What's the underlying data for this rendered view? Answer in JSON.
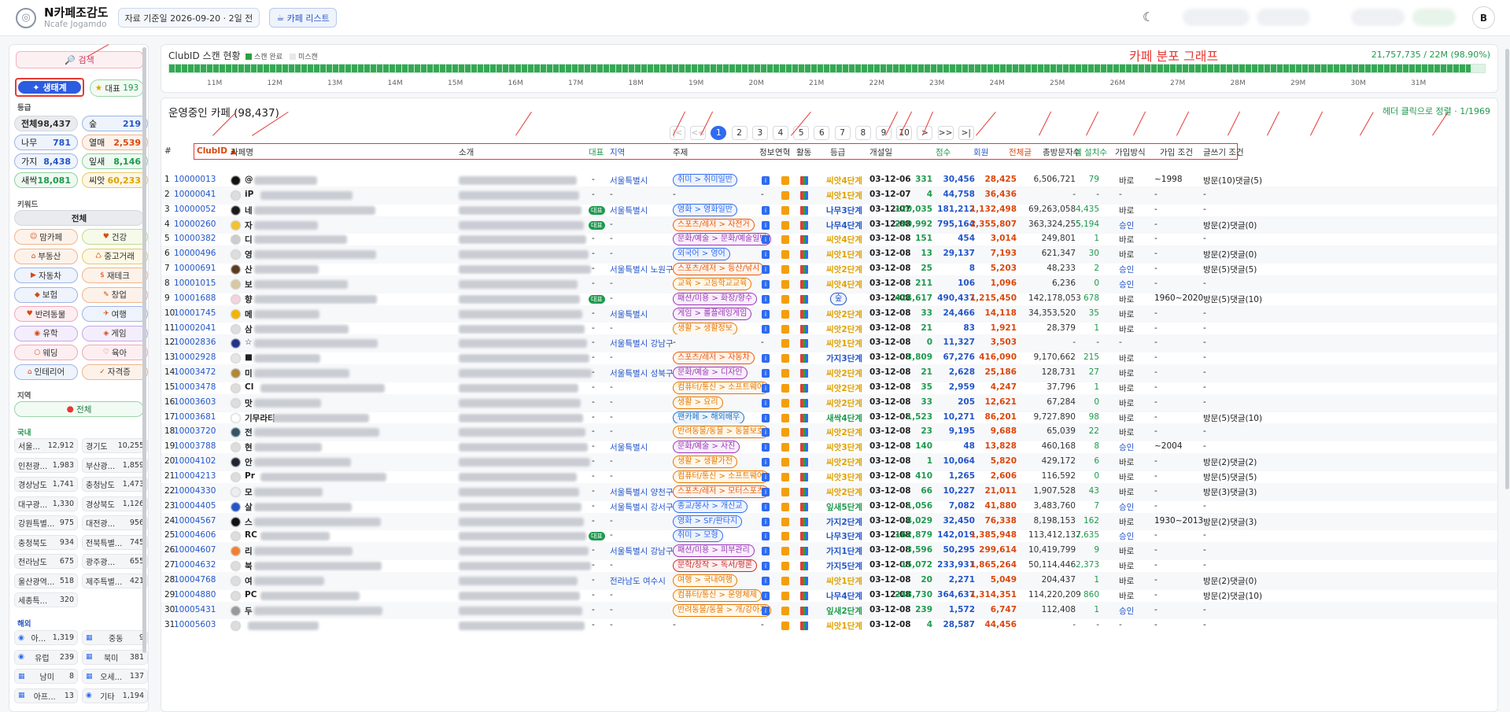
{
  "header": {
    "title": "N카페조감도",
    "subtitle": "Ncafe Jogamdo",
    "data_date": "자료 기준일 2026-09-20 · 2일 전",
    "cafe_list": "카페 리스트",
    "avatar": "B",
    "icon": "moon-icon"
  },
  "sidebar": {
    "search": "검색",
    "ecosystem": "생태계",
    "rep_label": "대표",
    "rep_count": "193",
    "grade_title": "등급",
    "grades": [
      {
        "l": "전체",
        "v": "98,437",
        "c": "#333"
      },
      {
        "l": "숲",
        "v": "219",
        "c": "#2456c8"
      },
      {
        "l": "나무",
        "v": "781",
        "c": "#2456c8"
      },
      {
        "l": "열매",
        "v": "2,539",
        "c": "#d9480f"
      },
      {
        "l": "가지",
        "v": "8,438",
        "c": "#2456c8"
      },
      {
        "l": "잎새",
        "v": "8,146",
        "c": "#1f9a4e"
      },
      {
        "l": "새싹",
        "v": "18,081",
        "c": "#1f9a4e"
      },
      {
        "l": "씨앗",
        "v": "60,233",
        "c": "#e0a100"
      }
    ],
    "keyword_title": "키워드",
    "keyword_all": "전체",
    "keywords": [
      "맘카페",
      "건강",
      "부동산",
      "중고거래",
      "자동차",
      "재테크",
      "보험",
      "창업",
      "반려동물",
      "여행",
      "유학",
      "게임",
      "웨딩",
      "육아",
      "인테리어",
      "자격증"
    ],
    "region_title": "지역",
    "region_all": "전체",
    "domestic": "국내",
    "regions": [
      {
        "l": "서울...",
        "v": "12,912"
      },
      {
        "l": "경기도",
        "v": "10,255"
      },
      {
        "l": "인천광...",
        "v": "1,983"
      },
      {
        "l": "부산광...",
        "v": "1,859"
      },
      {
        "l": "경상남도",
        "v": "1,741"
      },
      {
        "l": "충청남도",
        "v": "1,473"
      },
      {
        "l": "대구광...",
        "v": "1,330"
      },
      {
        "l": "경상북도",
        "v": "1,126"
      },
      {
        "l": "강원특별...",
        "v": "975"
      },
      {
        "l": "대전광...",
        "v": "956"
      },
      {
        "l": "충청북도",
        "v": "934"
      },
      {
        "l": "전북특별...",
        "v": "745"
      },
      {
        "l": "전라남도",
        "v": "675"
      },
      {
        "l": "광주광...",
        "v": "655"
      },
      {
        "l": "울산광역...",
        "v": "518"
      },
      {
        "l": "제주특별...",
        "v": "421"
      },
      {
        "l": "세종특...",
        "v": "320"
      }
    ],
    "overseas": "해외",
    "overseas_regions": [
      {
        "l": "아...",
        "v": "1,319"
      },
      {
        "l": "중동",
        "v": "9"
      },
      {
        "l": "유럽",
        "v": "239"
      },
      {
        "l": "북미",
        "v": "381"
      },
      {
        "l": "남미",
        "v": "8"
      },
      {
        "l": "오세...",
        "v": "137"
      },
      {
        "l": "아프...",
        "v": "13"
      },
      {
        "l": "기타",
        "v": "1,194"
      }
    ]
  },
  "scan": {
    "label": "ClubID 스캔 현황",
    "legend_done": "스캔 완료",
    "legend_not": "미스캔",
    "graph_title": "카페 분포 그래프",
    "total": "21,757,735 / 22M (98.90%)",
    "fill": 0.989,
    "ticks": [
      "11M",
      "12M",
      "13M",
      "14M",
      "15M",
      "16M",
      "17M",
      "18M",
      "19M",
      "20M",
      "21M",
      "22M",
      "23M",
      "24M",
      "25M",
      "26M",
      "27M",
      "28M",
      "29M",
      "30M",
      "31M"
    ]
  },
  "main": {
    "title": "운영중인 카페 (98,437)",
    "sort_hint": "헤더 클릭으로 정렬 · 1/1969",
    "pages": [
      "|<",
      "<<",
      "1",
      "2",
      "3",
      "4",
      "5",
      "6",
      "7",
      "8",
      "9",
      "10",
      ">",
      ">>",
      ">|"
    ],
    "columns": [
      "#",
      "ClubID ▲",
      "카페명",
      "소개",
      "대표",
      "지역",
      "주제",
      "정보",
      "연혁",
      "활동",
      "등급",
      "개설일",
      "점수",
      "회원",
      "전체글",
      "총방문자수",
      "앱 설치수",
      "가입방식",
      "가입 조건",
      "글쓰기 조건"
    ],
    "rows": [
      [
        "1",
        "10000013",
        "@",
        "-",
        "서울특별시",
        "취미 > 취미일반",
        "씨앗4단계",
        "03-12-06",
        "331",
        "30,456",
        "28,425",
        "6,506,721",
        "79",
        "바로",
        "~1998",
        "방문(10)댓글(5)"
      ],
      [
        "2",
        "10000041",
        "iP",
        "-",
        "-",
        "-",
        "씨앗1단계",
        "03-12-07",
        "4",
        "44,758",
        "36,436",
        "-",
        "-",
        "-",
        "-",
        "-"
      ],
      [
        "3",
        "10000052",
        "네",
        "대표",
        "서울특별시",
        "영화 > 영화일반",
        "나무3단계",
        "03-12-07",
        "120,035",
        "181,212",
        "1,132,498",
        "69,263,058",
        "4,435",
        "바로",
        "-",
        "-"
      ],
      [
        "4",
        "10000260",
        "자",
        "대표",
        "-",
        "스포츠/레저 > 자전거",
        "나무4단계",
        "03-12-08",
        "290,992",
        "795,164",
        "2,355,807",
        "363,324,255",
        "5,194",
        "승인",
        "-",
        "방문(2)댓글(0)"
      ],
      [
        "5",
        "10000382",
        "디",
        "-",
        "-",
        "문화/예술 > 문화/예술일반",
        "씨앗4단계",
        "03-12-08",
        "151",
        "454",
        "3,014",
        "249,801",
        "1",
        "바로",
        "-",
        "-"
      ],
      [
        "6",
        "10000496",
        "영",
        "-",
        "-",
        "외국어 > 영어",
        "씨앗1단계",
        "03-12-08",
        "13",
        "29,137",
        "7,193",
        "621,347",
        "30",
        "바로",
        "-",
        "방문(2)댓글(0)"
      ],
      [
        "7",
        "10000691",
        "산",
        "-",
        "서울특별시 노원구",
        "스포츠/레저 > 등산/낚시",
        "씨앗2단계",
        "03-12-08",
        "25",
        "8",
        "5,203",
        "48,233",
        "2",
        "승인",
        "-",
        "방문(5)댓글(5)"
      ],
      [
        "8",
        "10001015",
        "보",
        "-",
        "-",
        "교육 > 고등학교교육",
        "씨앗4단계",
        "03-12-08",
        "211",
        "106",
        "1,096",
        "6,236",
        "0",
        "승인",
        "-",
        "-"
      ],
      [
        "9",
        "10001688",
        "향",
        "대표",
        "-",
        "패션/미용 > 화장/향수",
        "숲",
        "03-12-08",
        "424,617",
        "490,437",
        "1,215,450",
        "142,178,053",
        "678",
        "바로",
        "1960~2020",
        "방문(5)댓글(10)"
      ],
      [
        "10",
        "10001745",
        "메",
        "-",
        "서울특별시",
        "게임 > 롤플레잉게임",
        "씨앗2단계",
        "03-12-08",
        "33",
        "24,466",
        "14,118",
        "34,353,520",
        "35",
        "바로",
        "-",
        "-"
      ],
      [
        "11",
        "10002041",
        "삼",
        "-",
        "-",
        "생활 > 생활정보",
        "씨앗2단계",
        "03-12-08",
        "21",
        "83",
        "1,921",
        "28,379",
        "1",
        "바로",
        "-",
        "-"
      ],
      [
        "12",
        "10002836",
        "☆",
        "-",
        "서울특별시 강남구",
        "-",
        "씨앗1단계",
        "03-12-08",
        "0",
        "11,327",
        "3,503",
        "-",
        "-",
        "-",
        "-",
        "-"
      ],
      [
        "13",
        "10002928",
        "■",
        "-",
        "-",
        "스포츠/레저 > 자동차",
        "가지3단계",
        "03-12-08",
        "3,809",
        "67,276",
        "416,090",
        "9,170,662",
        "215",
        "바로",
        "-",
        "-"
      ],
      [
        "14",
        "10003472",
        "미",
        "-",
        "서울특별시 성북구",
        "문화/예술 > 디자인",
        "씨앗2단계",
        "03-12-08",
        "21",
        "2,628",
        "25,186",
        "128,731",
        "27",
        "바로",
        "-",
        "-"
      ],
      [
        "15",
        "10003478",
        "Cl",
        "-",
        "-",
        "컴퓨터/통신 > 소프트웨어",
        "씨앗2단계",
        "03-12-08",
        "35",
        "2,959",
        "4,247",
        "37,796",
        "1",
        "바로",
        "-",
        "-"
      ],
      [
        "16",
        "10003603",
        "맛",
        "-",
        "-",
        "생활 > 요리",
        "씨앗2단계",
        "03-12-08",
        "33",
        "205",
        "12,621",
        "67,284",
        "0",
        "바로",
        "-",
        "-"
      ],
      [
        "17",
        "10003681",
        "기무라티",
        "-",
        "-",
        "팬카페 > 해외배우",
        "새싹4단계",
        "03-12-08",
        "1,523",
        "10,271",
        "86,201",
        "9,727,890",
        "98",
        "바로",
        "-",
        "방문(5)댓글(10)"
      ],
      [
        "18",
        "10003720",
        "전",
        "-",
        "-",
        "반려동물/동물 > 동물보호",
        "씨앗2단계",
        "03-12-08",
        "23",
        "9,195",
        "9,688",
        "65,039",
        "22",
        "바로",
        "-",
        "-"
      ],
      [
        "19",
        "10003788",
        "현",
        "-",
        "서울특별시",
        "문화/예술 > 사진",
        "씨앗3단계",
        "03-12-08",
        "140",
        "48",
        "13,828",
        "460,168",
        "8",
        "승인",
        "~2004",
        "-"
      ],
      [
        "20",
        "10004102",
        "안",
        "-",
        "-",
        "생활 > 생활가전",
        "씨앗2단계",
        "03-12-08",
        "1",
        "10,064",
        "5,820",
        "429,172",
        "6",
        "바로",
        "-",
        "방문(2)댓글(2)"
      ],
      [
        "21",
        "10004213",
        "Pr",
        "-",
        "-",
        "컴퓨터/통신 > 소프트웨어",
        "씨앗3단계",
        "03-12-08",
        "410",
        "1,265",
        "2,606",
        "116,592",
        "0",
        "바로",
        "-",
        "방문(5)댓글(5)"
      ],
      [
        "22",
        "10004330",
        "모",
        "-",
        "서울특별시 양천구",
        "스포츠/레저 > 모터스포츠",
        "씨앗2단계",
        "03-12-08",
        "66",
        "10,227",
        "21,011",
        "1,907,528",
        "43",
        "바로",
        "-",
        "방문(3)댓글(3)"
      ],
      [
        "23",
        "10004405",
        "살",
        "-",
        "서울특별시 강서구",
        "종교/봉사 > 개신교",
        "잎새5단계",
        "03-12-08",
        "1,056",
        "7,082",
        "41,880",
        "3,483,760",
        "7",
        "승인",
        "-",
        "-"
      ],
      [
        "24",
        "10004567",
        "스",
        "-",
        "-",
        "영화 > SF/판타지",
        "가지2단계",
        "03-12-08",
        "4,029",
        "32,450",
        "76,338",
        "8,198,153",
        "162",
        "바로",
        "1930~2013",
        "방문(2)댓글(3)"
      ],
      [
        "25",
        "10004606",
        "RC",
        "대표",
        "-",
        "취미 > 모형",
        "나무3단계",
        "03-12-08",
        "162,879",
        "142,019",
        "1,385,948",
        "113,412,137",
        "2,635",
        "승인",
        "-",
        "-"
      ],
      [
        "26",
        "10004607",
        "리",
        "-",
        "서울특별시 강남구",
        "패션/미용 > 피부관리",
        "가지1단계",
        "03-12-08",
        "3,596",
        "50,295",
        "299,614",
        "10,419,799",
        "9",
        "바로",
        "-",
        "-"
      ],
      [
        "27",
        "10004632",
        "북",
        "-",
        "-",
        "문학/창작 > 독서/평론",
        "가지5단계",
        "03-12-08",
        "15,072",
        "233,931",
        "1,865,264",
        "50,114,446",
        "2,373",
        "바로",
        "-",
        "-"
      ],
      [
        "28",
        "10004768",
        "여",
        "-",
        "전라남도 여수시",
        "여행 > 국내여행",
        "씨앗1단계",
        "03-12-08",
        "20",
        "2,271",
        "5,049",
        "204,437",
        "1",
        "바로",
        "-",
        "방문(2)댓글(0)"
      ],
      [
        "29",
        "10004880",
        "PC",
        "-",
        "-",
        "컴퓨터/통신 > 운영체제",
        "나무4단계",
        "03-12-08",
        "248,730",
        "364,637",
        "1,314,351",
        "114,220,209",
        "860",
        "바로",
        "-",
        "방문(2)댓글(10)"
      ],
      [
        "30",
        "10005431",
        "두",
        "-",
        "-",
        "반려동물/동물 > 개/강아지",
        "잎새2단계",
        "03-12-08",
        "239",
        "1,572",
        "6,747",
        "112,408",
        "1",
        "승인",
        "-",
        "-"
      ],
      [
        "31",
        "10005603",
        "",
        "-",
        "-",
        "-",
        "씨앗1단계",
        "03-12-08",
        "4",
        "28,587",
        "44,456",
        "-",
        "-",
        "-",
        "-",
        "-"
      ]
    ]
  }
}
